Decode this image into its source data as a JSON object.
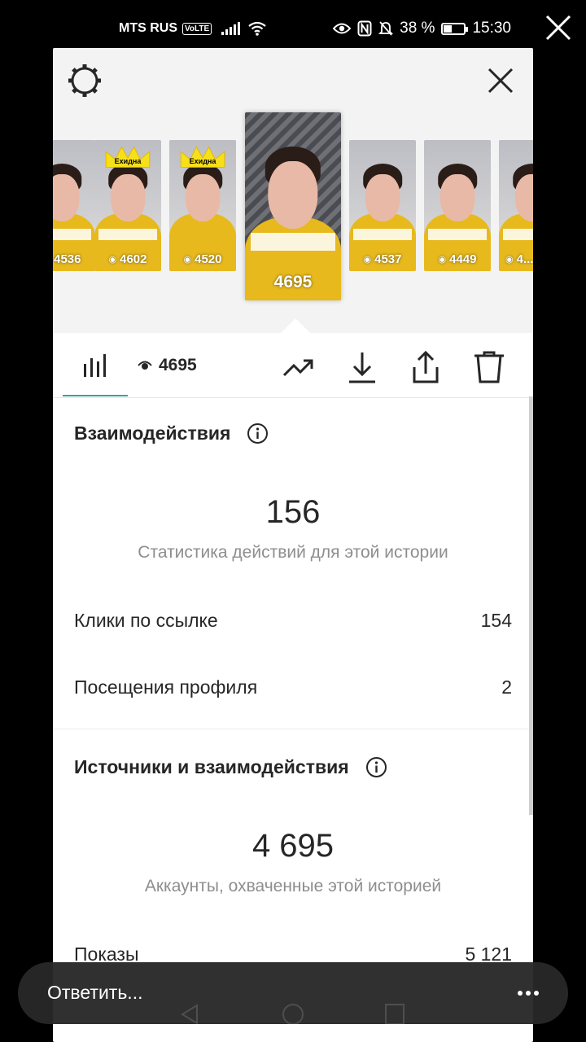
{
  "status_bar": {
    "carrier": "MTS RUS",
    "volte": "VoLTE",
    "battery": "38 %",
    "battery_level": 0.38,
    "time": "15:30"
  },
  "stories": [
    {
      "views": "4536"
    },
    {
      "views": "4602",
      "crown_label": "Ехидна"
    },
    {
      "views": "4520",
      "crown_label": "Ехидна"
    },
    {
      "views": "4695",
      "active": true
    },
    {
      "views": "4537"
    },
    {
      "views": "4449"
    },
    {
      "views": "4..."
    }
  ],
  "toolbar": {
    "views_count": "4695"
  },
  "interactions": {
    "title": "Взаимодействия",
    "total": "156",
    "subtitle": "Статистика действий для этой истории",
    "rows": [
      {
        "label": "Клики по ссылке",
        "value": "154"
      },
      {
        "label": "Посещения профиля",
        "value": "2"
      }
    ]
  },
  "discovery": {
    "title": "Источники и взаимодействия",
    "total": "4 695",
    "subtitle": "Аккаунты, охваченные этой историей",
    "rows": [
      {
        "label": "Показы",
        "value": "5 121"
      }
    ]
  },
  "reply": {
    "placeholder": "Ответить..."
  },
  "colors": {
    "accent": "#3aa0a8",
    "text": "#262626",
    "muted": "#8e8e8e",
    "shirt": "#e7b91d"
  }
}
